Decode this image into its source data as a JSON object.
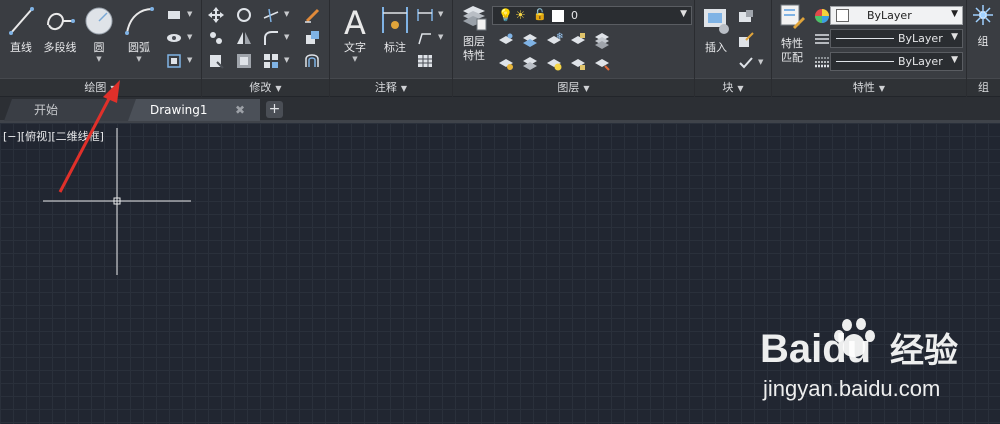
{
  "ribbon": {
    "draw_panel": {
      "footer": "绘图",
      "line": "直线",
      "polyline": "多段线",
      "circle": "圆",
      "arc": "圆弧"
    },
    "modify_panel": {
      "footer": "修改"
    },
    "annotation_panel": {
      "footer": "注释",
      "text": "文字",
      "dimension": "标注"
    },
    "layers_panel": {
      "footer": "图层",
      "layer_properties_line1": "图层",
      "layer_properties_line2": "特性",
      "current_layer": "0"
    },
    "block_panel": {
      "footer": "块",
      "insert": "插入"
    },
    "properties_panel": {
      "footer": "特性",
      "match_line1": "特性",
      "match_line2": "匹配",
      "color": "ByLayer",
      "linetype": "ByLayer",
      "lineweight": "ByLayer"
    },
    "groups_panel": {
      "footer": "组",
      "group": "组"
    }
  },
  "tabs": {
    "start": "开始",
    "drawing": "Drawing1",
    "close_glyph": "✖",
    "add_glyph": "+"
  },
  "viewport": {
    "label": "[−][俯视][二维线框]"
  },
  "watermark": {
    "brand": "Baidu",
    "brand_cn": "经验",
    "url": "jingyan.baidu.com"
  },
  "colors": {
    "annotation_arrow": "#e0302a",
    "background": "#212631",
    "ribbon": "#3a3d42"
  }
}
